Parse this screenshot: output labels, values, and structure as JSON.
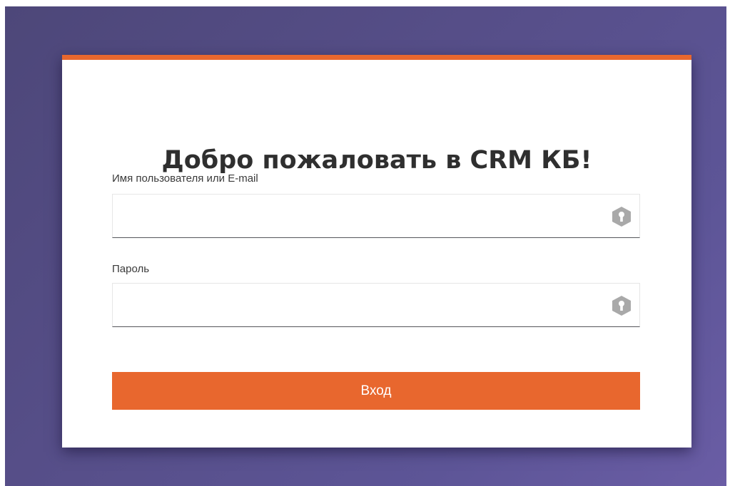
{
  "login": {
    "title": "Добро пожаловать в CRM КБ!",
    "username": {
      "label": "Имя пользователя или E-mail",
      "value": "",
      "icon": "key-icon"
    },
    "password": {
      "label": "Пароль",
      "value": "",
      "icon": "key-icon"
    },
    "submit_label": "Вход"
  },
  "colors": {
    "accent": "#e8672e",
    "background": "#574f8a",
    "icon": "#a9a9a9"
  }
}
